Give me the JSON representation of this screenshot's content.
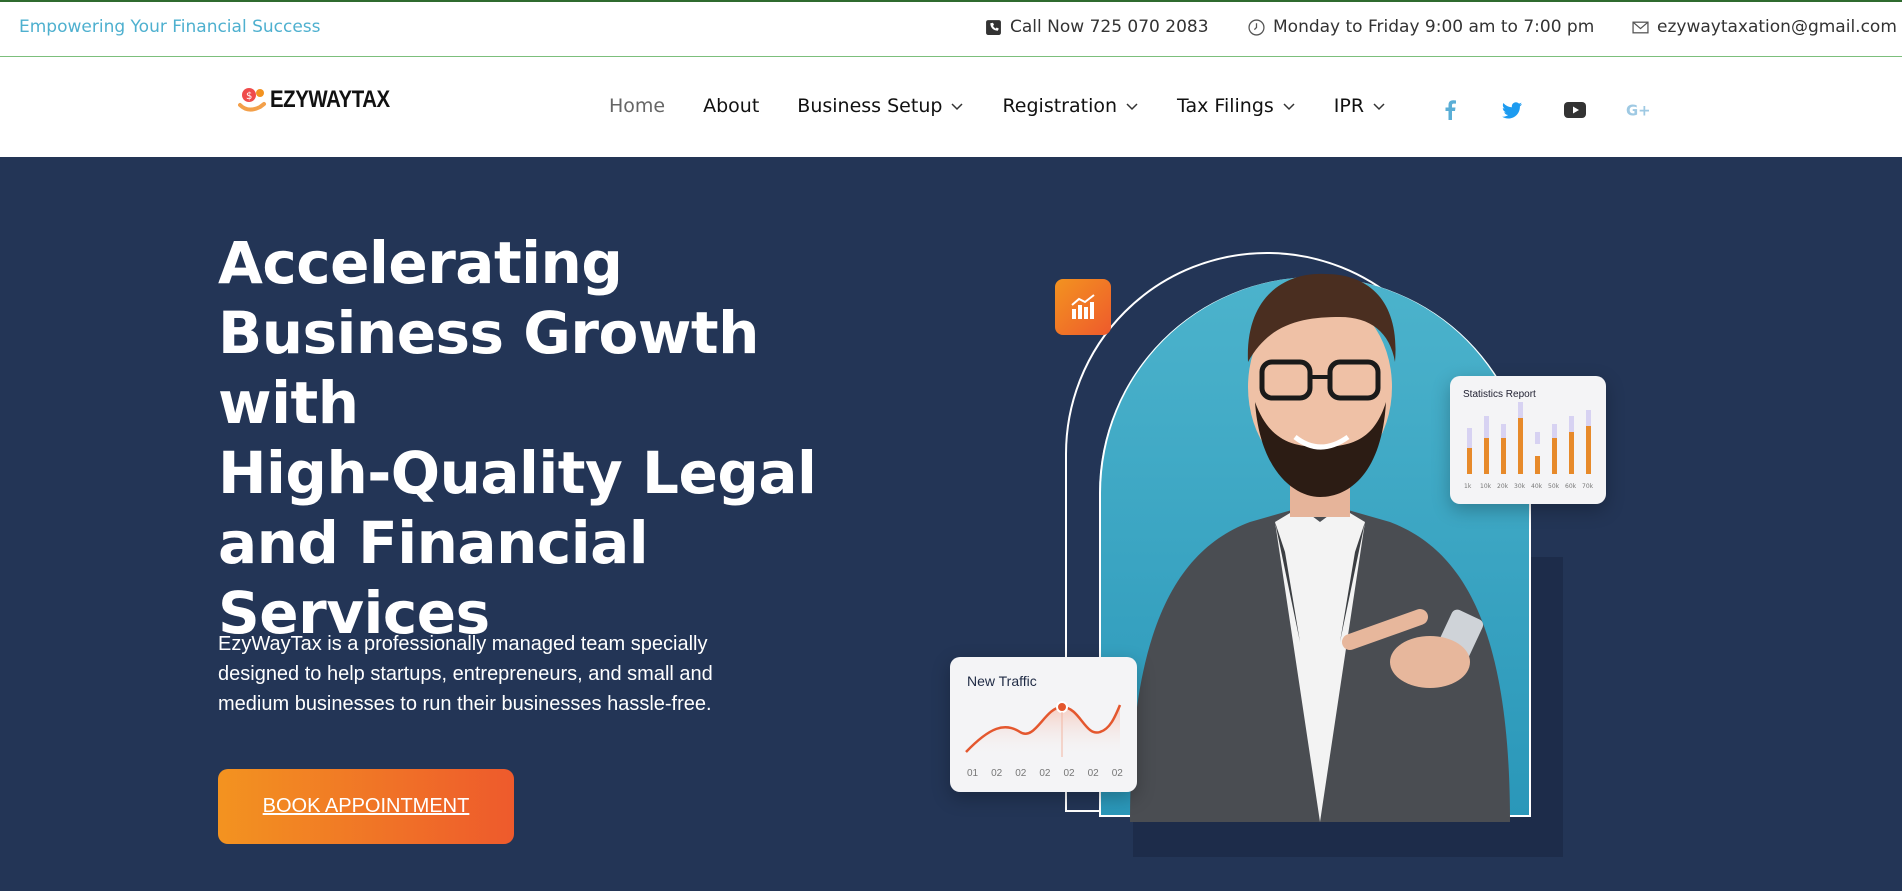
{
  "topbar": {
    "tagline": "Empowering Your Financial Success",
    "phone": "Call Now 725 070 2083",
    "hours": "Monday to Friday 9:00 am to 7:00 pm",
    "email": "ezywaytaxation@gmail.com"
  },
  "logo": {
    "text": "EZYWAYTAX"
  },
  "nav": {
    "items": [
      {
        "label": "Home",
        "active": true,
        "dropdown": false
      },
      {
        "label": "About",
        "active": false,
        "dropdown": false
      },
      {
        "label": "Business Setup",
        "active": false,
        "dropdown": true
      },
      {
        "label": "Registration",
        "active": false,
        "dropdown": true
      },
      {
        "label": "Tax Filings",
        "active": false,
        "dropdown": true
      },
      {
        "label": "IPR",
        "active": false,
        "dropdown": true
      }
    ]
  },
  "social": [
    "facebook-icon",
    "twitter-icon",
    "youtube-icon",
    "google-plus-icon"
  ],
  "hero": {
    "title_lines": [
      "Accelerating",
      "Business Growth with",
      "High-Quality Legal",
      "and Financial",
      "Services"
    ],
    "description": "EzyWayTax is a professionally managed team specially designed to help startups, entrepreneurs, and small and medium businesses to run their businesses hassle-free.",
    "cta": "BOOK APPOINTMENT"
  },
  "stats_card": {
    "title": "Statistics Report",
    "labels": [
      "1k",
      "10k",
      "20k",
      "30k",
      "40k",
      "50k",
      "60k",
      "70k"
    ]
  },
  "traffic_card": {
    "title": "New Traffic",
    "labels": [
      "01",
      "02",
      "02",
      "02",
      "02",
      "02",
      "02"
    ]
  },
  "colors": {
    "hero_bg": "#233556",
    "accent_orange": "#f39320",
    "accent_red": "#ee5a2c",
    "tagline_blue": "#4eb0cf",
    "arch_teal": "#2a97b9"
  }
}
